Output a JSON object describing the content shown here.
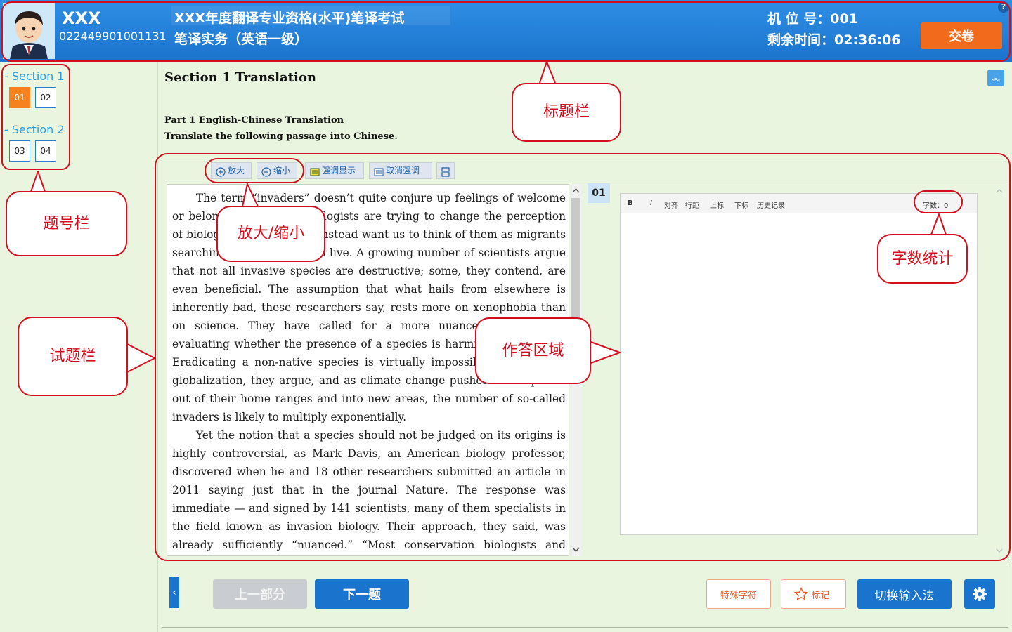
{
  "header": {
    "candidate_name": "XXX",
    "candidate_id": "022449901001131",
    "exam_title": "XXX年度翻译专业资格(水平)笔译考试",
    "exam_subtitle": "笔译实务（英语一级）",
    "seat_label": "机 位 号：001",
    "timer_label": "剩余时间：02:36:06",
    "submit_label": "交卷",
    "help_label": "?"
  },
  "sidebar": {
    "sections": [
      {
        "label": "- Section 1",
        "questions": [
          "01",
          "02"
        ]
      },
      {
        "label": "- Section 2",
        "questions": [
          "03",
          "04"
        ]
      }
    ],
    "active_question": "01"
  },
  "main": {
    "section_title": "Section 1 Translation",
    "part_title": "Part 1 English-Chinese Translation",
    "instruction": "Translate the following passage into Chinese.",
    "toolbar": {
      "zoom_in": "放大",
      "zoom_out": "缩小",
      "highlight": "强调显示",
      "unhighlight": "取消强调"
    },
    "passage_paragraphs": [
      "The term “invaders” doesn’t quite conjure up feelings of welcome or belonging. Yet some biologists are trying to change the perception of biological invaders and instead want us to think of them as migrants searching for new places to live. A growing number of scientists argue that not all invasive species are destructive; some, they contend, are even beneficial. The assumption that what hails from elsewhere is inherently bad, these researchers say, rests more on xenophobia than on science. They have called for a more nuanced approach to evaluating whether the presence of a species is harmful or beneficial. Eradicating a non-native species is virtually impossible in an era of globalization, they argue, and as climate change pushes more species out of their home ranges and into new areas, the number of so-called invaders is likely to multiply exponentially.",
      "Yet the notion that a species should not be judged on its origins is highly controversial, as Mark Davis, an American biology professor, discovered when he and 18 other researchers submitted an article in 2011 saying just that in the journal Nature. The response was immediate — and signed by 141 scientists, many of them specialists in the field known as invasion biology. Their approach, they said, was already sufficiently “nuanced.” “Most conservation biologists and ecologists do not oppose non-native species per se,” wrote Daniel Simberloff, a professor of"
    ],
    "question_number": "01",
    "editor": {
      "bold": "B",
      "italic": "I",
      "align": "对齐",
      "spacing": "行距",
      "superscript": "上标",
      "subscript": "下标",
      "history": "历史记录",
      "word_count": "字数：0"
    }
  },
  "bottom": {
    "prev_part": "上一部分",
    "next_question": "下一题",
    "special_chars": "特殊字符",
    "mark": "标记",
    "switch_ime": "切换输入法"
  },
  "annotations": {
    "title_bar": "标题栏",
    "question_bar": "题号栏",
    "zoom": "放大/缩小",
    "word_count": "字数统计",
    "question_area": "试题栏",
    "answer_area": "作答区域"
  },
  "colors": {
    "header_blue": "#1a73cc",
    "submit_orange": "#f26b1d",
    "annotation_red": "#d40e1e",
    "panel_green": "#eaf5e0"
  }
}
